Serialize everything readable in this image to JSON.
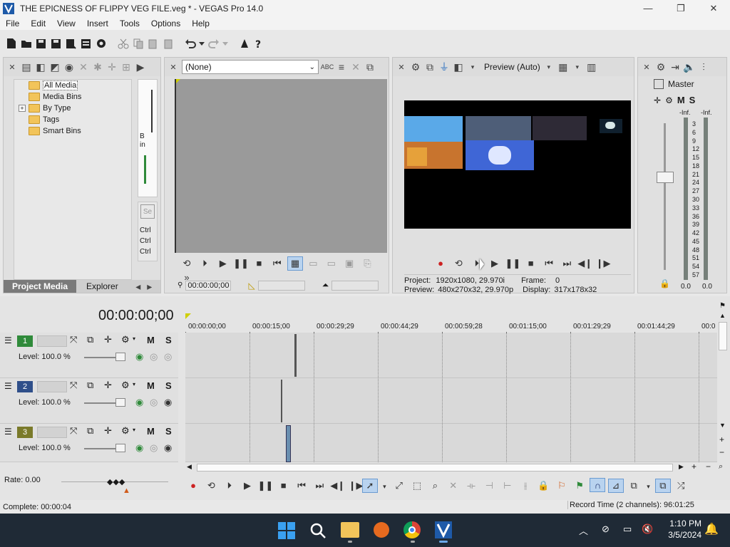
{
  "window": {
    "title": "THE EPICNESS OF FLIPPY VEG FILE.veg * - VEGAS Pro 14.0",
    "minimize": "—",
    "maximize": "❐",
    "close": "✕"
  },
  "menu": [
    "File",
    "Edit",
    "View",
    "Insert",
    "Tools",
    "Options",
    "Help"
  ],
  "project_media": {
    "tree": [
      {
        "label": "All Media",
        "selected": true,
        "expandable": false
      },
      {
        "label": "Media Bins",
        "selected": false,
        "expandable": false
      },
      {
        "label": "By Type",
        "selected": false,
        "expandable": true
      },
      {
        "label": "Tags",
        "selected": false,
        "expandable": false
      },
      {
        "label": "Smart Bins",
        "selected": false,
        "expandable": false
      }
    ],
    "side_text_1": "B",
    "side_text_2": "in",
    "ctrl_labels": [
      "Ctrl",
      "Ctrl",
      "Ctrl"
    ],
    "tabs": [
      "Project Media",
      "Explorer"
    ],
    "active_tab": "Project Media"
  },
  "trimmer": {
    "dropdown_value": "(None)",
    "timecode": "00:00:00;00"
  },
  "preview": {
    "mode_label": "Preview (Auto)",
    "project_label": "Project:",
    "project_value": "1920x1080, 29.970i",
    "preview_label": "Preview:",
    "preview_value": "480x270x32, 29.970p",
    "frame_label": "Frame:",
    "frame_value": "0",
    "display_label": "Display:",
    "display_value": "317x178x32"
  },
  "master": {
    "title": "Master",
    "m_label": "M",
    "s_label": "S",
    "inf_left": "-Inf.",
    "inf_right": "-Inf.",
    "scale": [
      "3",
      "6",
      "9",
      "12",
      "15",
      "18",
      "21",
      "24",
      "27",
      "30",
      "33",
      "36",
      "39",
      "42",
      "45",
      "48",
      "51",
      "54",
      "57"
    ],
    "bottom_left": "0.0",
    "bottom_right": "0.0"
  },
  "timeline": {
    "cursor_time": "00:00:00;00",
    "ruler": [
      "00:00:00;00",
      "00:00:15;00",
      "00:00:29;29",
      "00:00:44;29",
      "00:00:59;28",
      "00:01:15;00",
      "00:01:29;29",
      "00:01:44;29",
      "00:0"
    ],
    "tracks": [
      {
        "number": "1",
        "level": "Level: 100.0 %",
        "m": "M",
        "s": "S",
        "type": "video"
      },
      {
        "number": "2",
        "level": "Level: 100.0 %",
        "m": "M",
        "s": "S",
        "type": "video"
      },
      {
        "number": "3",
        "level": "Level: 100.0 %",
        "m": "M",
        "s": "S",
        "type": "video"
      }
    ],
    "rate": "Rate: 0.00"
  },
  "status": {
    "complete": "Complete: 00:00:04",
    "record_time": "Record Time (2 channels): 96:01:25"
  },
  "taskbar": {
    "time": "1:10 PM",
    "date": "3/5/2024"
  },
  "colors": {
    "accent_blue": "#2a6ebf",
    "folder_yellow": "#f2c45a",
    "track1_green": "#2f8a3a",
    "track2_blue": "#2f4f8a",
    "track3_olive": "#7a7a2a",
    "timeline_bg": "#d9d9d9",
    "taskbar_bg": "#1f2a36"
  }
}
